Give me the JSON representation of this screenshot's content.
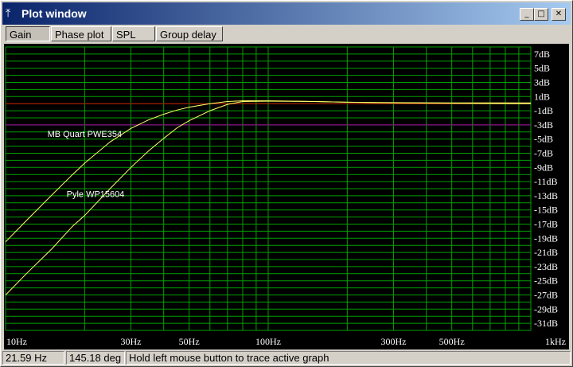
{
  "window": {
    "title": "Plot window",
    "icon": "plot-app-icon",
    "controls": {
      "minimize": "_",
      "maximize": "□",
      "close": "✕"
    }
  },
  "tabs": [
    {
      "label": "Gain",
      "active": true
    },
    {
      "label": "Phase plot",
      "active": false
    },
    {
      "label": "SPL",
      "active": false
    },
    {
      "label": "Group delay",
      "active": false
    }
  ],
  "status": {
    "frequency": "21.59 Hz",
    "phase": "145.18 deg",
    "message": "Hold left mouse button to trace active graph"
  },
  "colors": {
    "background": "#000000",
    "grid": "#00a000",
    "text": "#ffffff",
    "curve": "#ffff66",
    "ref_red": "#cc0000",
    "ref_purple": "#aa00aa"
  },
  "chart_data": {
    "type": "line",
    "x_scale": "log",
    "xlim": [
      10,
      1000
    ],
    "ylim": [
      -32,
      8
    ],
    "y_ticks": [
      "7dB",
      "5dB",
      "3dB",
      "1dB",
      "-1dB",
      "-3dB",
      "-5dB",
      "-7dB",
      "-9dB",
      "-11dB",
      "-13dB",
      "-15dB",
      "-17dB",
      "-19dB",
      "-21dB",
      "-23dB",
      "-25dB",
      "-27dB",
      "-29dB",
      "-31dB"
    ],
    "y_tick_values": [
      7,
      5,
      3,
      1,
      -1,
      -3,
      -5,
      -7,
      -9,
      -11,
      -13,
      -15,
      -17,
      -19,
      -21,
      -23,
      -25,
      -27,
      -29,
      -31
    ],
    "x_tick_labels": [
      "10Hz",
      "30Hz",
      "50Hz",
      "100Hz",
      "300Hz",
      "500Hz",
      "1kHz"
    ],
    "x_tick_values": [
      10,
      30,
      50,
      100,
      300,
      500,
      1000
    ],
    "reference_lines": [
      {
        "y": 0,
        "color": "#cc0000"
      },
      {
        "y": -3,
        "color": "#aa00aa"
      }
    ],
    "grid": true,
    "series": [
      {
        "name": "MB Quart PWE354",
        "label_at": {
          "x": 20,
          "y": -4.7
        },
        "x": [
          10,
          12,
          15,
          18,
          20,
          25,
          30,
          35,
          40,
          45,
          50,
          60,
          70,
          80,
          100,
          150,
          200,
          300,
          500,
          1000
        ],
        "y": [
          -19.5,
          -16.5,
          -12.9,
          -10.0,
          -8.4,
          -5.4,
          -3.5,
          -2.3,
          -1.5,
          -0.9,
          -0.5,
          0.0,
          0.3,
          0.4,
          0.4,
          0.3,
          0.2,
          0.15,
          0.1,
          0.1
        ]
      },
      {
        "name": "Pyle WP15604",
        "label_at": {
          "x": 22,
          "y": -13.2
        },
        "x": [
          10,
          12,
          15,
          18,
          20,
          25,
          30,
          35,
          40,
          45,
          50,
          60,
          70,
          80,
          100,
          150,
          200,
          300,
          500,
          1000
        ],
        "y": [
          -27.0,
          -24.0,
          -20.5,
          -17.3,
          -15.8,
          -12.0,
          -9.0,
          -6.7,
          -4.9,
          -3.4,
          -2.4,
          -1.0,
          -0.1,
          0.3,
          0.35,
          0.3,
          0.2,
          0.1,
          0.05,
          0.0
        ]
      }
    ]
  }
}
